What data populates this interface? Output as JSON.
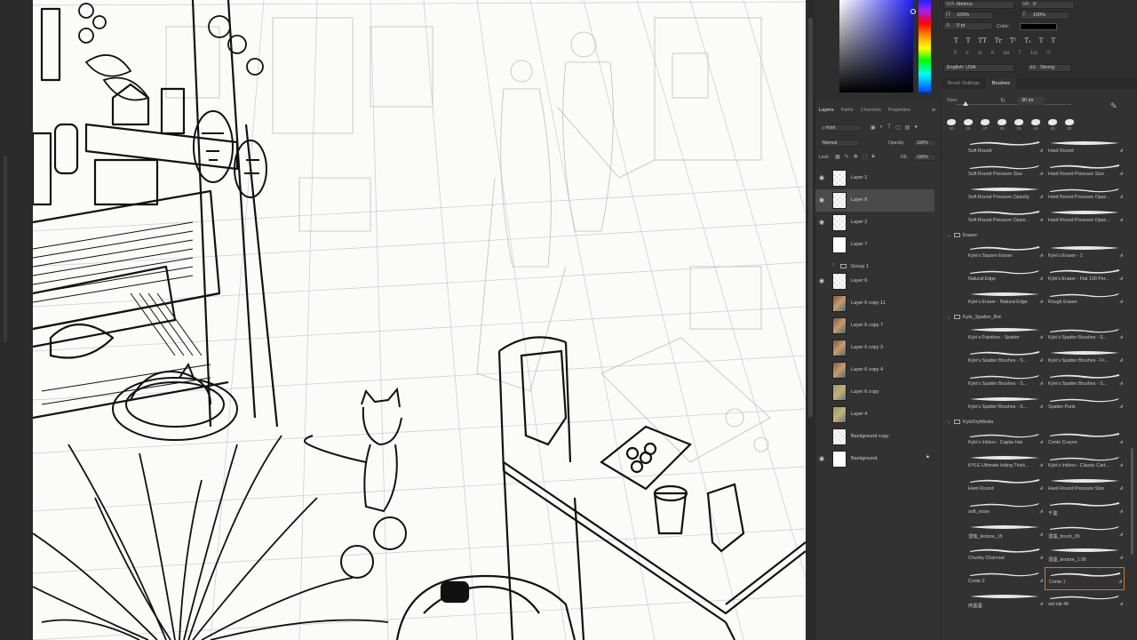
{
  "character_panel": {
    "font_style": "Metrics",
    "tracking_value": "0",
    "vertical_scale": "100%",
    "horizontal_scale": "100%",
    "baseline_shift": "0 pt",
    "color_label": "Color:",
    "type_styles": [
      "T",
      "T",
      "TT",
      "Tr",
      "T¹",
      "T₁",
      "T",
      "T"
    ],
    "opentype": [
      "fi",
      "σ",
      "st",
      "A",
      "aa",
      "T",
      "1st",
      "½"
    ],
    "language": "English: USA",
    "antialias": "Strong"
  },
  "brush_tabs": [
    "Brush Settings",
    "Brushes"
  ],
  "brushes_panel": {
    "size_label": "Size:",
    "size_value": "30 px",
    "recent_sizes": [
      "30",
      "25",
      "67",
      "25",
      "25",
      "40",
      "40",
      "80"
    ],
    "items": [
      {
        "name": "Soft Round",
        "col": 0,
        "row": 0
      },
      {
        "name": "Hard Round",
        "col": 1,
        "row": 0
      },
      {
        "name": "Soft Round Pressure Size",
        "col": 0,
        "row": 1
      },
      {
        "name": "Hard Round Pressure Size",
        "col": 1,
        "row": 1
      },
      {
        "name": "Soft Round Pressure Opacity",
        "col": 0,
        "row": 2
      },
      {
        "name": "Hard Round Pressure Opac...",
        "col": 1,
        "row": 2
      },
      {
        "name": "Soft Round Pressure Opaci...",
        "col": 0,
        "row": 3
      },
      {
        "name": "Hard Round Pressure Opac...",
        "col": 1,
        "row": 3
      }
    ],
    "groups": [
      {
        "name": "Eraser",
        "items": [
          "Kyle's Square Eraser",
          "Kyle's Eraser - 1",
          "Natural Edge",
          "Kyle's Eraser - Flat 100 Per...",
          "Kyle's Eraser - Natural Edge",
          "Rough Eraser"
        ]
      },
      {
        "name": "Kyle_Spatter_Bot",
        "items": [
          "Kyle's Paintbox - Spatter",
          "Kyle's Spatter Brushes - S...",
          "Kyle's Spatter Brushes - S...",
          "Kyle's Spatter Brushes - Fr...",
          "Kyle's Spatter Brushes - S...",
          "Kyle's Spatter Brushes - S...",
          "Kyle's Spatter Brushes - S...",
          "Spatter Punk"
        ]
      },
      {
        "name": "KyleDryMedia",
        "items": [
          "Kyle's Inkbox - Caplar Hat",
          "Conte Crayon",
          "KYLE Ultimate Inking Thick...",
          "Kyle's Inkbox - Classic Cart...",
          "Hard Round",
          "Hard Round Pressure Size",
          "soft_noise",
          "千墨",
          "湿笔_texture_15",
          "湿墨_brush_05",
          "Chunky Charcoal",
          "湿墨_texture_1.06",
          "Conte 2",
          "Conte 1",
          "肉墨墨",
          "oid nib 40"
        ]
      }
    ],
    "selected_brush": "Conte 1"
  },
  "layers_panel": {
    "tabs": [
      "Layers",
      "Paths",
      "Channels",
      "Properties"
    ],
    "active_tab": "Layers",
    "filter_kind": "Kind",
    "blend_mode": "Normal",
    "opacity_label": "Opacity:",
    "opacity_value": "100%",
    "lock_label": "Lock:",
    "fill_label": "Fill:",
    "fill_value": "100%",
    "layers": [
      {
        "name": "Layer 1",
        "visible": true,
        "thumb": "transparent"
      },
      {
        "name": "Layer 8",
        "visible": true,
        "thumb": "transparent",
        "selected": true
      },
      {
        "name": "Layer 2",
        "visible": true,
        "thumb": "transparent"
      },
      {
        "name": "Layer 7",
        "visible": false,
        "thumb": "white"
      },
      {
        "name": "Group 1",
        "visible": false,
        "thumb": "group"
      },
      {
        "name": "Layer 6",
        "visible": true,
        "thumb": "transparent"
      },
      {
        "name": "Layer 6 copy 11",
        "visible": false,
        "thumb": "art"
      },
      {
        "name": "Layer 6 copy 7",
        "visible": false,
        "thumb": "art"
      },
      {
        "name": "Layer 6 copy 3",
        "visible": false,
        "thumb": "art"
      },
      {
        "name": "Layer 6 copy 4",
        "visible": false,
        "thumb": "art"
      },
      {
        "name": "Layer 6 copy",
        "visible": false,
        "thumb": "art2"
      },
      {
        "name": "Layer 4",
        "visible": false,
        "thumb": "art2"
      },
      {
        "name": "Background copy",
        "visible": false,
        "thumb": "sketch"
      },
      {
        "name": "Background",
        "visible": true,
        "thumb": "white",
        "locked": true
      }
    ]
  },
  "colors": {
    "accent_selected": "#c97a2e",
    "panel_bg": "#323232",
    "canvas_bg": "#fbfbfa"
  }
}
